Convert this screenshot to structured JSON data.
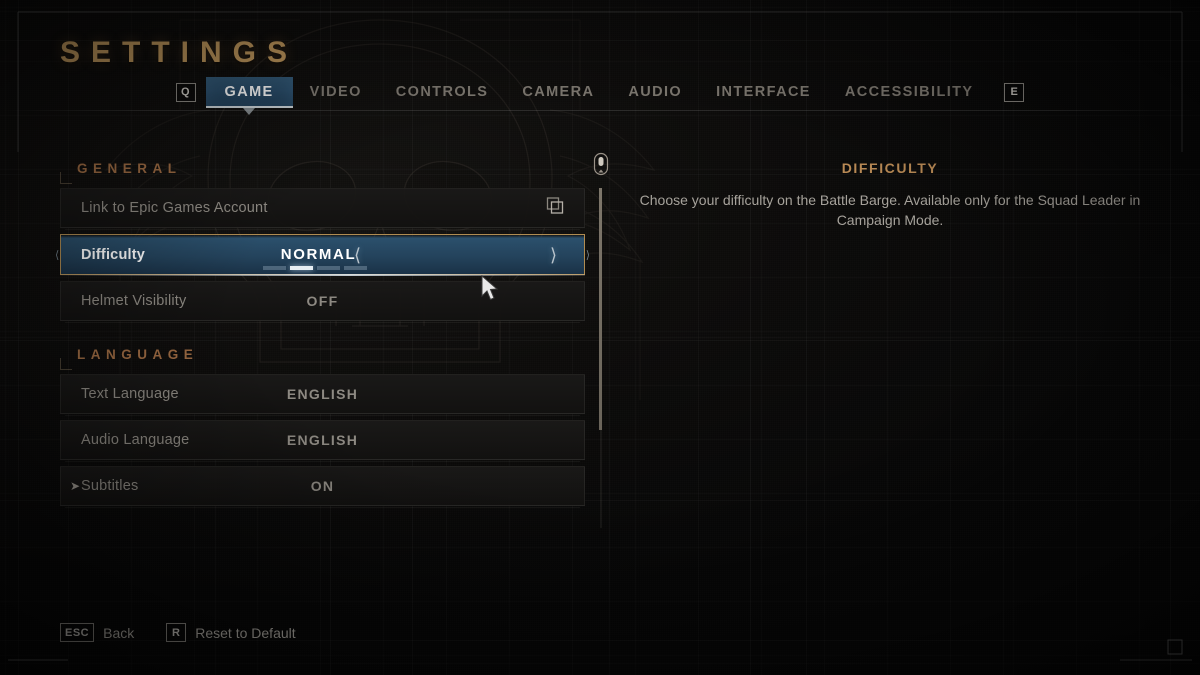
{
  "header": {
    "title": "SETTINGS"
  },
  "tabs": {
    "prev_key": "Q",
    "next_key": "E",
    "items": [
      {
        "label": "GAME",
        "active": true
      },
      {
        "label": "VIDEO",
        "active": false
      },
      {
        "label": "CONTROLS",
        "active": false
      },
      {
        "label": "CAMERA",
        "active": false
      },
      {
        "label": "AUDIO",
        "active": false
      },
      {
        "label": "INTERFACE",
        "active": false
      },
      {
        "label": "ACCESSIBILITY",
        "active": false
      }
    ]
  },
  "sections": [
    {
      "title": "GENERAL",
      "rows": [
        {
          "label": "Link to Epic Games Account",
          "value": "",
          "icon": "external-link-icon"
        },
        {
          "label": "Difficulty",
          "value": "NORMAL",
          "selected": true,
          "segments_total": 4,
          "segment_active": 2
        },
        {
          "label": "Helmet Visibility",
          "value": "OFF"
        }
      ]
    },
    {
      "title": "LANGUAGE",
      "rows": [
        {
          "label": "Text Language",
          "value": "ENGLISH"
        },
        {
          "label": "Audio Language",
          "value": "ENGLISH"
        },
        {
          "label": "Subtitles",
          "value": "ON",
          "expandable": true
        }
      ]
    }
  ],
  "description": {
    "title": "DIFFICULTY",
    "body": "Choose your difficulty on the Battle Barge. Available only for the Squad Leader in Campaign Mode."
  },
  "scroll": {
    "icon": "mouse-wheel-icon"
  },
  "footer": {
    "items": [
      {
        "key": "ESC",
        "label": "Back"
      },
      {
        "key": "R",
        "label": "Reset to Default"
      }
    ]
  },
  "colors": {
    "accent_gold": "#c39a5e",
    "section_head": "#9d6b43",
    "selected_border": "#b08c52",
    "selected_fill": "#2b506c",
    "tab_active_fill": "#2e536f"
  }
}
